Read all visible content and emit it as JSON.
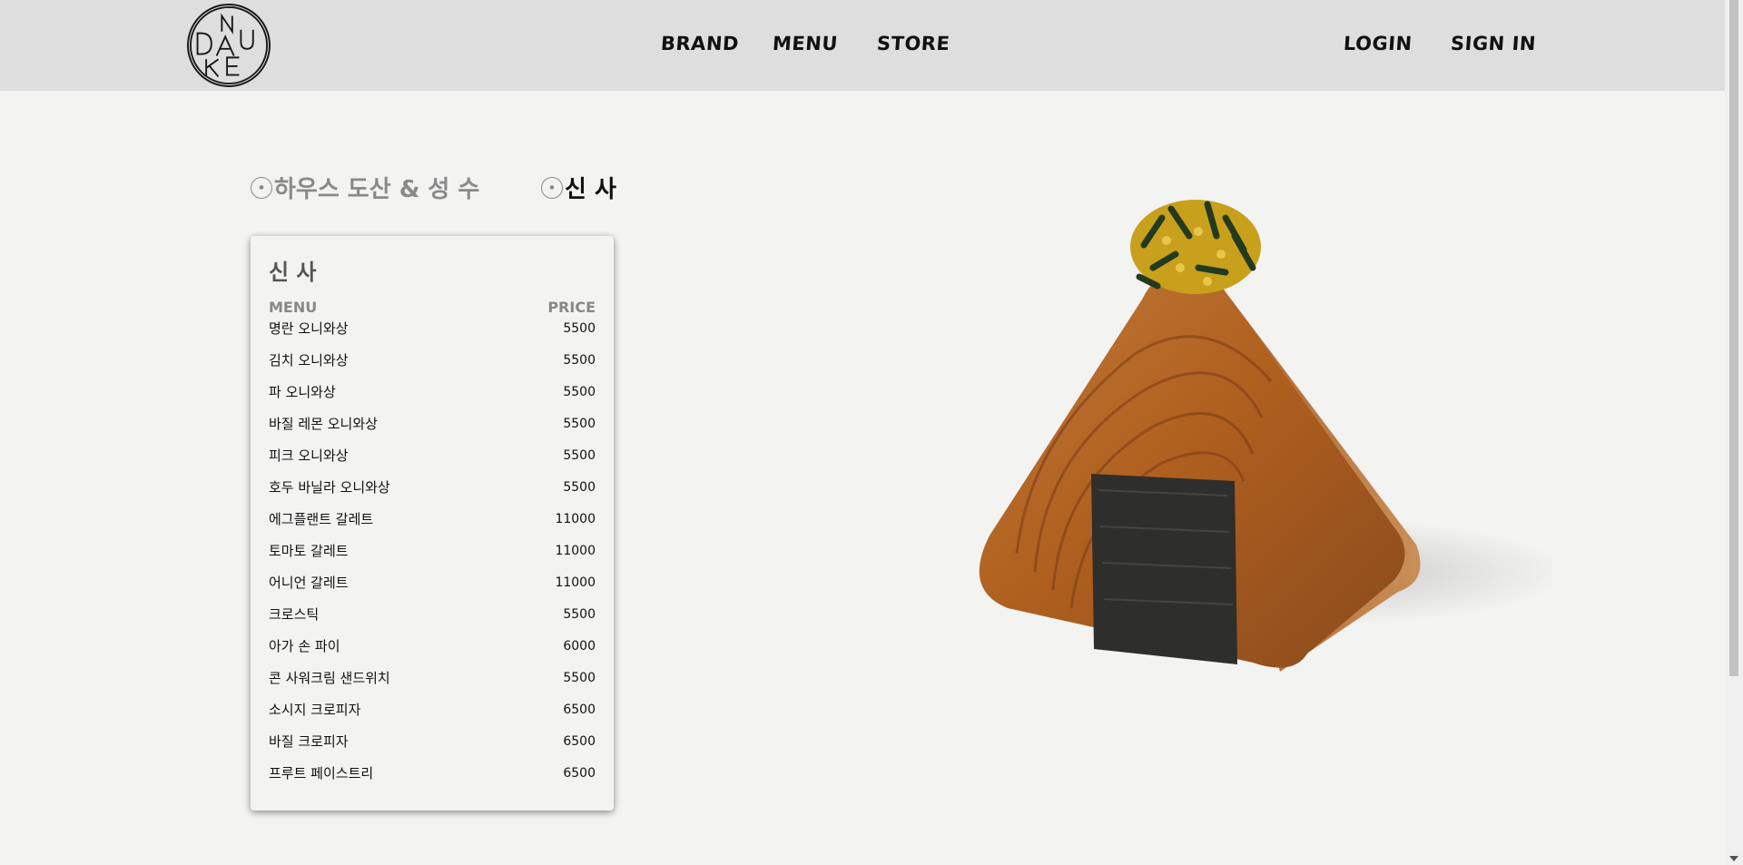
{
  "header": {
    "logo_text": "DNUKE",
    "nav": [
      {
        "label": "BRAND"
      },
      {
        "label": "MENU"
      },
      {
        "label": "STORE"
      }
    ],
    "auth": [
      {
        "label": "LOGIN"
      },
      {
        "label": "SIGN IN"
      }
    ]
  },
  "stores": [
    {
      "label": "하우스 도산 & 성 수",
      "active": false
    },
    {
      "label": "신 사",
      "active": true
    }
  ],
  "menu_card": {
    "title": "신 사",
    "col_menu": "MENU",
    "col_price": "PRICE",
    "items": [
      {
        "name": "명란 오니와상",
        "price": "5500"
      },
      {
        "name": "김치 오니와상",
        "price": "5500"
      },
      {
        "name": "파 오니와상",
        "price": "5500"
      },
      {
        "name": "바질 레몬 오니와상",
        "price": "5500"
      },
      {
        "name": "피크 오니와상",
        "price": "5500"
      },
      {
        "name": "호두 바닐라 오니와상",
        "price": "5500"
      },
      {
        "name": "에그플랜트 갈레트",
        "price": "11000"
      },
      {
        "name": "토마토 갈레트",
        "price": "11000"
      },
      {
        "name": "어니언 갈레트",
        "price": "11000"
      },
      {
        "name": "크로스틱",
        "price": "5500"
      },
      {
        "name": "아가 손 파이",
        "price": "6000"
      },
      {
        "name": "콘 사워크림 샌드위치",
        "price": "5500"
      },
      {
        "name": "소시지 크로피자",
        "price": "6500"
      },
      {
        "name": "바질 크로피자",
        "price": "6500"
      },
      {
        "name": "프루트 페이스트리",
        "price": "6500"
      }
    ]
  },
  "colors": {
    "header_bg": "#dedede",
    "page_bg": "#f3f3f2",
    "pastry": "#b8672a",
    "seaweed": "#2e2e2c"
  }
}
